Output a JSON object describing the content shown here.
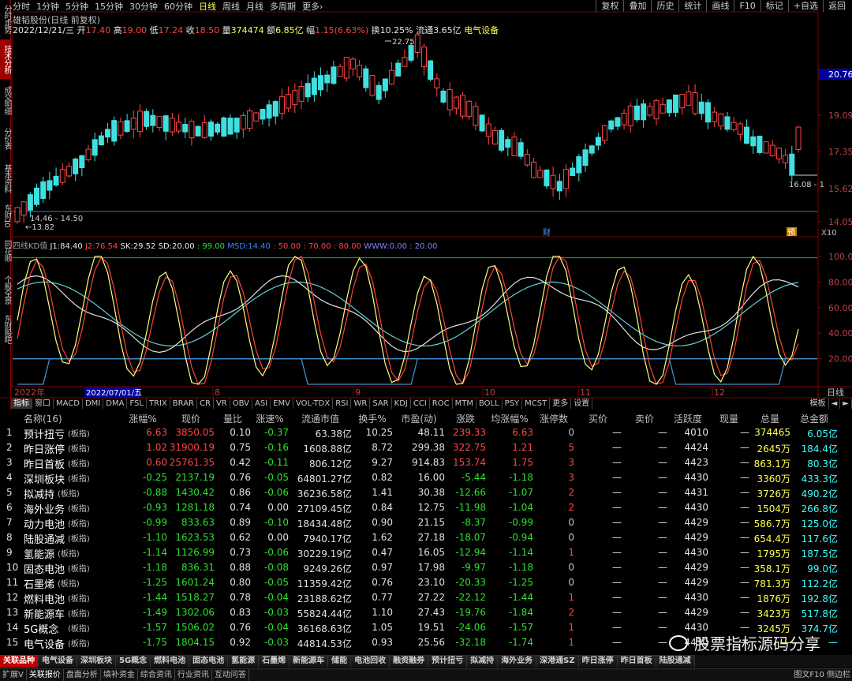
{
  "left_tabs": [
    {
      "label": "分时走势",
      "active": false
    },
    {
      "label": "技术分析",
      "active": true
    },
    {
      "label": "成交明细",
      "active": false
    },
    {
      "label": "分价表",
      "active": false
    },
    {
      "label": "基本资料",
      "active": false
    },
    {
      "label": "东财10",
      "active": false
    },
    {
      "label": "同花顺",
      "active": false
    },
    {
      "label": "个股全景",
      "active": false
    },
    {
      "label": "东财股吧",
      "active": false
    }
  ],
  "periods": [
    {
      "label": "分时",
      "active": false
    },
    {
      "label": "1分钟",
      "active": false
    },
    {
      "label": "5分钟",
      "active": false
    },
    {
      "label": "15分钟",
      "active": false
    },
    {
      "label": "30分钟",
      "active": false
    },
    {
      "label": "60分钟",
      "active": false
    },
    {
      "label": "日线",
      "active": true
    },
    {
      "label": "周线",
      "active": false
    },
    {
      "label": "月线",
      "active": false
    },
    {
      "label": "多周期",
      "active": false
    },
    {
      "label": "更多›",
      "active": false
    }
  ],
  "tools": [
    "复权",
    "叠加",
    "历史",
    "统计",
    "画线",
    "F10",
    "标记",
    "+自选",
    "返回"
  ],
  "stock": {
    "title": "雄韬股份(日线 前复权)",
    "date": "2022/12/21/三",
    "open_label": "开",
    "open": "17.40",
    "high_label": "高",
    "high": "19.00",
    "low_label": "低",
    "low": "17.24",
    "close_label": "收",
    "close": "18.50",
    "vol_label": "量",
    "vol": "374474",
    "amount_label": "额",
    "amount": "6.85亿",
    "change_label": "幅",
    "change": "1.15(6.63%)",
    "turnover_label": "换",
    "turnover": "10.25%",
    "float_label": "流通",
    "float": "3.65亿",
    "sector": "电气设备"
  },
  "price_axis": [
    "20.76",
    "19.09",
    "17.35",
    "15.62",
    "14.05"
  ],
  "price_annotations": {
    "high_mark": "22.75",
    "low_mark": "←13.82",
    "range_mark": "14.46 - 14.50",
    "last_mark": "16.08 - 1",
    "cai1": "财",
    "cai2": "预",
    "x10": "X10"
  },
  "kd_header": {
    "name": "四线KD值",
    "j1_label": "J1:",
    "j1": "84.40",
    "j2_label": "J2:",
    "j2": "76.54",
    "sk_label": "SK:",
    "sk": "29.52",
    "sd_label": "SD:",
    "sd": "20.00",
    "c99": ": 99.00",
    "msd_label": "MSD:",
    "msd": "14.40",
    "c50": ": 50.00",
    "c70": ": 70.00",
    "c80": ": 80.00",
    "www_label": "WWW:",
    "www": "0.00",
    "c20": ": 20.00"
  },
  "kd_axis": [
    "100.0",
    "80.00",
    "60.00",
    "40.00",
    "20.00"
  ],
  "date_axis": {
    "year": "2022年",
    "cursor": "2022/07/01/五",
    "months": [
      "8",
      "9",
      "10",
      "11",
      "12"
    ],
    "right_label": "日线"
  },
  "indicator_tabs": [
    "指标",
    "窗口",
    "MACD",
    "DMI",
    "DMA",
    "FSL",
    "TRIX",
    "BRAR",
    "CR",
    "VR",
    "OBV",
    "ASI",
    "EMV",
    "VOL-TDX",
    "RSI",
    "WR",
    "SAR",
    "KDJ",
    "CCI",
    "ROC",
    "MTM",
    "BOLL",
    "PSY",
    "MCST",
    "更多",
    "设置"
  ],
  "indicator_right": [
    "模板",
    "◄",
    "►"
  ],
  "table": {
    "headers": [
      "名称(16)",
      "涨幅%",
      "现价",
      "量比",
      "涨速%",
      "流通市值",
      "换手%",
      "市盈(动)",
      "涨跌",
      "均涨幅%",
      "涨停数",
      "买价",
      "卖价",
      "活跃度",
      "现量",
      "总量",
      "总金额"
    ],
    "rows": [
      [
        "1",
        "预计扭亏",
        "(板指)",
        "6.63",
        "3850.05",
        "0.10",
        "-0.37",
        "63.38亿",
        "10.25",
        "48.11",
        "239.33",
        "6.63",
        "0",
        "—",
        "—",
        "4010",
        "—",
        "374465",
        "6.05亿"
      ],
      [
        "2",
        "昨日涨停",
        "(板指)",
        "1.02",
        "31900.19",
        "0.75",
        "-0.16",
        "1608.88亿",
        "8.72",
        "299.38",
        "322.75",
        "1.21",
        "5",
        "—",
        "—",
        "4424",
        "—",
        "2645万",
        "184.4亿"
      ],
      [
        "3",
        "昨日首板",
        "(板指)",
        "0.60",
        "25761.35",
        "0.42",
        "-0.11",
        "806.12亿",
        "9.27",
        "914.83",
        "153.74",
        "1.75",
        "3",
        "—",
        "—",
        "4423",
        "—",
        "863.1万",
        "80.3亿"
      ],
      [
        "4",
        "深圳板块",
        "(板指)",
        "-0.25",
        "2137.19",
        "0.76",
        "-0.05",
        "64801.27亿",
        "0.82",
        "16.00",
        "-5.44",
        "-1.18",
        "3",
        "—",
        "—",
        "4430",
        "—",
        "3360万",
        "433.3亿"
      ],
      [
        "5",
        "拟减持",
        "(板指)",
        "-0.88",
        "1430.42",
        "0.86",
        "-0.06",
        "36236.58亿",
        "1.41",
        "30.38",
        "-12.66",
        "-1.07",
        "2",
        "—",
        "—",
        "4431",
        "—",
        "3726万",
        "490.2亿"
      ],
      [
        "6",
        "海外业务",
        "(板指)",
        "-0.93",
        "1281.18",
        "0.74",
        "0.00",
        "27109.45亿",
        "0.84",
        "12.75",
        "-11.98",
        "-1.04",
        "2",
        "—",
        "—",
        "4430",
        "—",
        "1504万",
        "266.8亿"
      ],
      [
        "7",
        "动力电池",
        "(板指)",
        "-0.99",
        "833.63",
        "0.89",
        "-0.10",
        "18434.48亿",
        "0.90",
        "21.15",
        "-8.37",
        "-0.99",
        "0",
        "—",
        "—",
        "4429",
        "—",
        "586.7万",
        "125.0亿"
      ],
      [
        "8",
        "陆股通减",
        "(板指)",
        "-1.10",
        "1623.53",
        "0.62",
        "0.00",
        "7940.17亿",
        "1.62",
        "27.18",
        "-18.07",
        "-0.94",
        "0",
        "—",
        "—",
        "4429",
        "—",
        "654.4万",
        "117.6亿"
      ],
      [
        "9",
        "氢能源",
        "(板指)",
        "-1.14",
        "1126.99",
        "0.73",
        "-0.06",
        "30229.19亿",
        "0.47",
        "16.05",
        "-12.94",
        "-1.14",
        "1",
        "—",
        "—",
        "4430",
        "—",
        "1795万",
        "187.5亿"
      ],
      [
        "10",
        "固态电池",
        "(板指)",
        "-1.18",
        "836.31",
        "0.88",
        "-0.08",
        "9249.26亿",
        "0.97",
        "17.98",
        "-9.97",
        "-1.18",
        "0",
        "—",
        "—",
        "4429",
        "—",
        "358.1万",
        "99.0亿"
      ],
      [
        "11",
        "石墨烯",
        "(板指)",
        "-1.25",
        "1601.24",
        "0.80",
        "-0.05",
        "11359.42亿",
        "0.76",
        "23.10",
        "-20.33",
        "-1.25",
        "0",
        "—",
        "—",
        "4429",
        "—",
        "781.3万",
        "112.2亿"
      ],
      [
        "12",
        "燃料电池",
        "(板指)",
        "-1.44",
        "1518.27",
        "0.78",
        "-0.04",
        "23188.62亿",
        "0.77",
        "27.22",
        "-22.12",
        "-1.44",
        "1",
        "—",
        "—",
        "4430",
        "—",
        "1876万",
        "192.8亿"
      ],
      [
        "13",
        "新能源车",
        "(板指)",
        "-1.49",
        "1302.06",
        "0.83",
        "-0.03",
        "55824.44亿",
        "1.10",
        "27.43",
        "-19.76",
        "-1.84",
        "2",
        "—",
        "—",
        "4429",
        "—",
        "3423万",
        "517.8亿"
      ],
      [
        "14",
        "5G概念",
        "(板指)",
        "-1.57",
        "1506.02",
        "0.76",
        "-0.04",
        "36168.63亿",
        "1.05",
        "19.51",
        "-24.06",
        "-1.57",
        "1",
        "—",
        "—",
        "4430",
        "—",
        "3245万",
        "374.7亿"
      ],
      [
        "15",
        "电气设备",
        "(板指)",
        "-1.75",
        "1804.15",
        "0.92",
        "-0.03",
        "44814.53亿",
        "0.93",
        "25.56",
        "-32.18",
        "-1.74",
        "1",
        "—",
        "—",
        "4430",
        "—",
        "—",
        "—"
      ]
    ]
  },
  "bottom_tabs": [
    "关联品种",
    "电气设备",
    "深圳板块",
    "5G概念",
    "燃料电池",
    "固态电池",
    "氢能源",
    "石墨烯",
    "新能源车",
    "储能",
    "电池回收",
    "融资融券",
    "预计扭亏",
    "拟减持",
    "海外业务",
    "深港通SZ",
    "昨日涨停",
    "昨日首板",
    "陆股通减"
  ],
  "status_tabs": [
    "扩展V",
    "关联报价",
    "盘面分析",
    "填补资金",
    "综合资讯",
    "行业资讯",
    "互动问答"
  ],
  "status_right": "图文F10 侧边栏",
  "watermark": "股票指标源码分享",
  "colors": {
    "up": "#ff4545",
    "down": "#40e0e0",
    "bg": "#000000",
    "grid": "#800000",
    "j1": "#ffff80",
    "j2": "#ff4040",
    "sk": "#e0e0e0",
    "sd": "#40e0e0"
  }
}
